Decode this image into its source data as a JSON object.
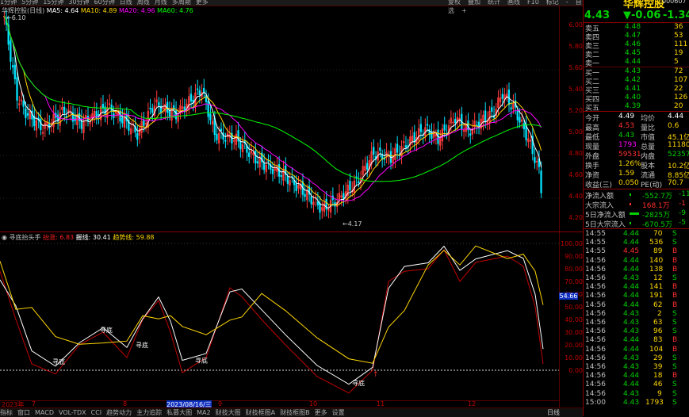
{
  "topbar": {
    "tabs": [
      "1分钟",
      "5分钟",
      "15分钟",
      "30分钟",
      "60分钟",
      "日线",
      "周线",
      "月线",
      "多周期",
      "更多"
    ],
    "buttons": [
      "复权",
      "叠加",
      "统计",
      "画线",
      "F10",
      "标记",
      "-",
      "自选",
      "+"
    ]
  },
  "stock": {
    "name": "华辉控股",
    "code": "000607",
    "price": "4.43",
    "change": "▼-0.06",
    "change_pct": "-1.34%"
  },
  "price_chart": {
    "title": "华辉控股(日线)",
    "ma_labels": [
      {
        "label": "MA5: 4.64",
        "color": "#ffffff"
      },
      {
        "label": "MA10: 4.89",
        "color": "#ffd700"
      },
      {
        "label": "MA20: 4.96",
        "color": "#ff00ff"
      },
      {
        "label": "MA60: 4.76",
        "color": "#00ff00"
      }
    ],
    "high_marker": "6.10",
    "low_marker": "4.17",
    "y_axis": [
      "6.00",
      "5.80",
      "5.60",
      "5.40",
      "5.20",
      "5.00",
      "4.80",
      "4.60",
      "4.40",
      "4.20"
    ]
  },
  "indicator": {
    "name": "寻底抬头手",
    "legend": [
      {
        "label": "抬涨: 6.83",
        "color": "#ff2020"
      },
      {
        "label": "握线: 30.41",
        "color": "#ffffff"
      },
      {
        "label": "趋势线: 59.88",
        "color": "#ffd700"
      }
    ],
    "y_axis": [
      "100.00",
      "90.00",
      "80.00",
      "70.00",
      "60.00",
      "50.00",
      "40.00",
      "30.00",
      "20.00",
      "10.00",
      "0.00"
    ],
    "current_value": "54.66",
    "signal_label": "寻底",
    "signal_count": 6
  },
  "date_axis": {
    "labels": [
      "2023年",
      "7",
      "8",
      "2023/08/16/三",
      "9",
      "10",
      "11",
      "12"
    ]
  },
  "order_book": {
    "asks": [
      {
        "label": "卖五",
        "price": "4.48",
        "vol": "36"
      },
      {
        "label": "卖四",
        "price": "4.47",
        "vol": "53"
      },
      {
        "label": "卖三",
        "price": "4.46",
        "vol": "111"
      },
      {
        "label": "卖二",
        "price": "4.45",
        "vol": "19"
      },
      {
        "label": "卖一",
        "price": "4.44",
        "vol": "5"
      }
    ],
    "bids": [
      {
        "label": "买一",
        "price": "4.43",
        "vol": "72"
      },
      {
        "label": "买二",
        "price": "4.42",
        "vol": "107"
      },
      {
        "label": "买三",
        "price": "4.41",
        "vol": "22"
      },
      {
        "label": "买四",
        "price": "4.40",
        "vol": "126"
      },
      {
        "label": "买五",
        "price": "4.39",
        "vol": "20"
      }
    ]
  },
  "stats": [
    {
      "l1": "今开",
      "v1": "4.49",
      "c1": "#ffffff",
      "l2": "均价",
      "v2": "4.44",
      "c2": "#ffffff"
    },
    {
      "l1": "最高",
      "v1": "4.53",
      "c1": "#ff3030",
      "l2": "量比",
      "v2": "0.6",
      "c2": "#ffd700"
    },
    {
      "l1": "最低",
      "v1": "4.43",
      "c1": "#00d000",
      "l2": "市值",
      "v2": "45.1亿",
      "c2": "#ffd700"
    },
    {
      "l1": "现量",
      "v1": "1793",
      "c1": "#ff00ff",
      "l2": "总量",
      "v2": "11180",
      "c2": "#ffd700"
    },
    {
      "l1": "外盘",
      "v1": "59531",
      "c1": "#ff3030",
      "l2": "内盘",
      "v2": "52357",
      "c2": "#00d000"
    },
    {
      "l1": "换手",
      "v1": "1.26%",
      "c1": "#ffd700",
      "l2": "股本",
      "v2": "10.2亿",
      "c2": "#ffd700"
    },
    {
      "l1": "净资",
      "v1": "1.59",
      "c1": "#ffd700",
      "l2": "流通",
      "v2": "8.85亿",
      "c2": "#ffd700"
    },
    {
      "l1": "收益(三)",
      "v1": "0.050",
      "c1": "#ffd700",
      "l2": "PE(动)",
      "v2": "70.7",
      "c2": "#ffd700"
    }
  ],
  "flows": [
    {
      "label": "净流入额",
      "value": "-552.7万",
      "tail": "-11",
      "color": "#00d000"
    },
    {
      "label": "大宗流入",
      "value": "168.1万",
      "tail": "-1",
      "color": "#ff3030"
    },
    {
      "label": "5日净流入额",
      "value": "-2825万",
      "tail": "-9",
      "color": "#00d000"
    },
    {
      "label": "5日大宗流入",
      "value": "-670.5万",
      "tail": "-5",
      "color": "#00d000"
    }
  ],
  "ticks": [
    {
      "t": "14:55",
      "p": "4.44",
      "v": "70",
      "s": "S"
    },
    {
      "t": "14:55",
      "p": "4.44",
      "v": "536",
      "s": "S"
    },
    {
      "t": "14:55",
      "p": "4.45",
      "v": "89",
      "s": "B"
    },
    {
      "t": "14:56",
      "p": "4.44",
      "v": "140",
      "s": "B"
    },
    {
      "t": "14:56",
      "p": "4.44",
      "v": "138",
      "s": "B"
    },
    {
      "t": "14:56",
      "p": "4.43",
      "v": "12",
      "s": "S"
    },
    {
      "t": "14:56",
      "p": "4.44",
      "v": "141",
      "s": "B"
    },
    {
      "t": "14:56",
      "p": "4.44",
      "v": "191",
      "s": "B"
    },
    {
      "t": "14:56",
      "p": "4.44",
      "v": "62",
      "s": "B"
    },
    {
      "t": "14:56",
      "p": "4.43",
      "v": "2",
      "s": "S"
    },
    {
      "t": "14:56",
      "p": "4.43",
      "v": "63",
      "s": "S"
    },
    {
      "t": "14:56",
      "p": "4.43",
      "v": "96",
      "s": "S"
    },
    {
      "t": "14:56",
      "p": "4.44",
      "v": "83",
      "s": "B"
    },
    {
      "t": "14:56",
      "p": "4.44",
      "v": "104",
      "s": "B"
    },
    {
      "t": "14:56",
      "p": "4.43",
      "v": "29",
      "s": "S"
    },
    {
      "t": "14:56",
      "p": "4.43",
      "v": "39",
      "s": "S"
    },
    {
      "t": "14:56",
      "p": "4.44",
      "v": "18",
      "s": "B"
    },
    {
      "t": "14:56",
      "p": "4.44",
      "v": "46",
      "s": "S"
    },
    {
      "t": "14:56",
      "p": "4.43",
      "v": "9",
      "s": "S"
    },
    {
      "t": "15:00",
      "p": "4.43",
      "v": "1793",
      "s": "S"
    }
  ],
  "bottombar": {
    "tabs": [
      "指标",
      "窗口",
      "MACD",
      "VOL-TDX",
      "CCI",
      "趋势动力",
      "主力追踪",
      "私募大图",
      "MA2",
      "财技大图",
      "财技框图A",
      "财技框图B",
      "更多",
      "设置"
    ],
    "right": "日线"
  }
}
